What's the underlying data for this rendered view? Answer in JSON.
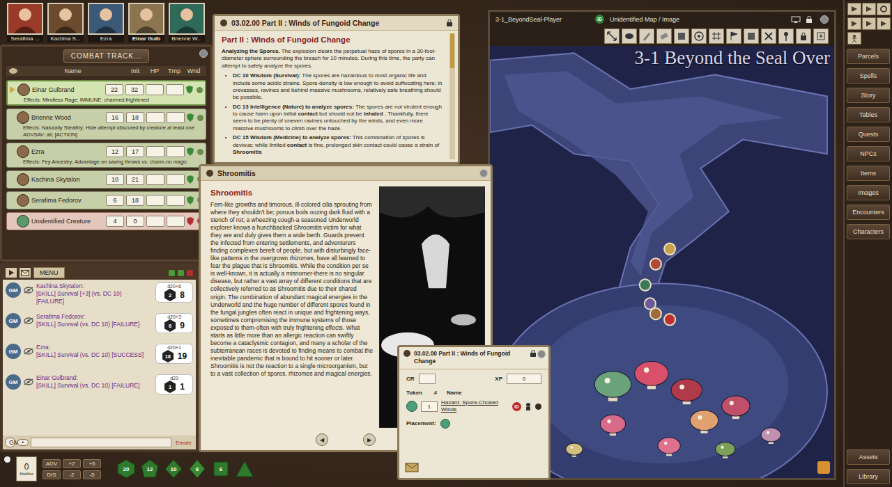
{
  "party": [
    {
      "name": "Serafima ...",
      "selected": false
    },
    {
      "name": "Kachina S...",
      "selected": false
    },
    {
      "name": "Ezra",
      "selected": false
    },
    {
      "name": "Einar Gulb",
      "selected": true
    },
    {
      "name": "Brienne W...",
      "selected": false
    }
  ],
  "combat_tracker": {
    "title": "COMBAT TRACK...",
    "columns": [
      "Name",
      "Init",
      "HP",
      "Tmp",
      "Wnd"
    ],
    "rows": [
      {
        "name": "Einar Gulbrand",
        "init": "22",
        "hp": "32",
        "active": true,
        "faction": "friend",
        "effects": [
          "Effects: Mindless Rage; IMMUNE: charmed,frightened"
        ]
      },
      {
        "name": "Brienne Wood",
        "init": "16",
        "hp": "18",
        "active": false,
        "faction": "friend",
        "effects": [
          "Effects: Naturally Stealthy; Hide attempt obscured by creature at least one",
          "ADVSAV: all; [ACTION]"
        ]
      },
      {
        "name": "Ezra",
        "init": "12",
        "hp": "17",
        "active": false,
        "faction": "friend",
        "effects": [
          "Effects: Fey Ancestry; Advantage on saving throws vs. charm,no magic"
        ]
      },
      {
        "name": "Kachina Skytalon",
        "init": "10",
        "hp": "21",
        "active": false,
        "faction": "friend",
        "effects": []
      },
      {
        "name": "Serafima Fedorov",
        "init": "6",
        "hp": "18",
        "active": false,
        "faction": "friend",
        "effects": []
      },
      {
        "name": "Unidentified Creature",
        "init": "4",
        "hp": "0",
        "active": false,
        "faction": "foe",
        "effects": []
      }
    ]
  },
  "chat": {
    "menu": "MENU",
    "identity": "GM",
    "emote": "Emote",
    "messages": [
      {
        "sender": "GM",
        "actor": "Kachina Skytalon:",
        "lines": [
          "[SKILL] Survival [+3] (vs. DC 10)",
          "[FAILURE]"
        ],
        "dice": "d20+6",
        "roll": "2",
        "total": "8"
      },
      {
        "sender": "GM",
        "actor": "Serafima Fedorov:",
        "lines": [
          "[SKILL] Survival (vs. DC 10) [FAILURE]"
        ],
        "dice": "d20+3",
        "roll": "6",
        "total": "9"
      },
      {
        "sender": "GM",
        "actor": "Ezra:",
        "lines": [
          "[SKILL] Survival (vs. DC 10) [SUCCESS]"
        ],
        "dice": "d20+1",
        "roll": "18",
        "total": "19"
      },
      {
        "sender": "GM",
        "actor": "Einar Gulbrand:",
        "lines": [
          "[SKILL] Survival (vs. DC 10) [FAILURE]"
        ],
        "dice": "d20",
        "roll": "1",
        "total": "1"
      }
    ]
  },
  "hotbar": {
    "modifier": {
      "value": "0",
      "label": "Modifier"
    },
    "modifier_buttons": [
      "ADV",
      "+2",
      "+5",
      "DIS",
      "-2",
      "-5"
    ],
    "dice": [
      {
        "kind": "d20",
        "label": "20"
      },
      {
        "kind": "d12",
        "label": "12"
      },
      {
        "kind": "d10",
        "label": "10"
      },
      {
        "kind": "d8",
        "label": "8"
      },
      {
        "kind": "d6",
        "label": "6"
      },
      {
        "kind": "d4"
      }
    ]
  },
  "story": {
    "title": "03.02.00 Part II : Winds of Fungoid Change",
    "heading": "Part II : Winds of Fungoid Change",
    "intro_lead": "Analyzing the Spores.",
    "intro": " The explosion clears the perpetual haze of spores in a 30-foot-diameter sphere surrounding the breach for 10 minutes. During this time, the party can attempt to safely analyze the spores.",
    "bullets": [
      {
        "lead": "DC 10 Wisdom (Survival):",
        "parts": [
          {
            "text": " The spores are hazardous to most organic life and include some acidic strains. Spore-density is low enough to avoid suffocating here; in crevasses, ravines and behind massive mushrooms, relatively safe breathing should be possible.",
            "bold": false
          }
        ]
      },
      {
        "lead": "DC 13 Intelligence (Nature) to analyze spores:",
        "parts": [
          {
            "text": " The spores are not virulent enough to cause harm upon initial ",
            "bold": false
          },
          {
            "text": "contact",
            "bold": true
          },
          {
            "text": " but should not be ",
            "bold": false
          },
          {
            "text": "inhaled",
            "bold": true
          },
          {
            "text": " . Thankfully, there seem to be plenty of uneven ravines untouched by the winds, and even more massive mushrooms to climb over the haze.",
            "bold": false
          }
        ]
      },
      {
        "lead": "DC 15 Wisdom (Medicine) to analyze spores:",
        "parts": [
          {
            "text": " This combination of spores is devious; while limited ",
            "bold": false
          },
          {
            "text": "contact",
            "bold": true
          },
          {
            "text": " is fine, prolonged skin contact could cause a strain of ",
            "bold": false
          },
          {
            "text": "Shroomitis",
            "bold": true
          }
        ]
      }
    ]
  },
  "shroomitis": {
    "title": "Shroomitis",
    "heading": "Shroomitis",
    "body": "Fern-like growths and timorous, ill-colored cilia sprouting from where they shouldn't be; porous boils oozing dark fluid with a stench of rot; a wheezing cough-a seasoned Underworld explorer knows a hunchbacked Shroomitis victim for what they are and duly gives them a wide berth. Guards prevent the infected from entering settlements, and adventurers finding complexes bereft of people, but with disturbingly face-like patterns in the overgrown rhizomes, have all learned to fear the plague that is Shroomitis. While the condition per se is well-known, it is actually a misnomer-there is no singular disease, but rather a vast array of different conditions that are collectively referred to as Shroomitis due to their shared origin. The combination of abundant magical energies in the Underworld and the huge number of different spores found in the fungal jungles often react in unique and frightening ways, sometimes compromising the immune systems of those exposed to them-often with truly frightening effects. What starts as little more than an allergic reaction can swiftly become a cataclysmic contagion, and many a scholar of the subterranean races is devoted to finding means to combat the inevitable pandemic that is bound to hit sooner or later. Shroomitis is not the reaction to a single microorganism, but to a vast collection of spores, rhizomes and magical energies.",
    "nav": [
      "◀",
      "▶"
    ]
  },
  "encounter": {
    "title": "03.02.00 Part II : Winds of Fungoid Change",
    "cr_label": "CR",
    "xp_label": "XP",
    "xp": "0",
    "columns": [
      "Token",
      "#",
      "Name"
    ],
    "rows": [
      {
        "count": "1",
        "name": "Hazard: Spore-Choked Winds",
        "badge": "ID"
      }
    ],
    "placement": "Placement:"
  },
  "map": {
    "title": "3-1_BeyondSeal-Player",
    "badge": "ID",
    "status": "Unidentified Map / Image",
    "caption": "3-1 Beyond the Seal Over"
  },
  "sidebar": {
    "buttons": [
      "Parcels",
      "Spells",
      "Story",
      "Tables",
      "Quests",
      "NPCs",
      "Items",
      "Images",
      "Encounters",
      "Characters"
    ],
    "bottom_buttons": [
      "Assets",
      "Library"
    ]
  }
}
